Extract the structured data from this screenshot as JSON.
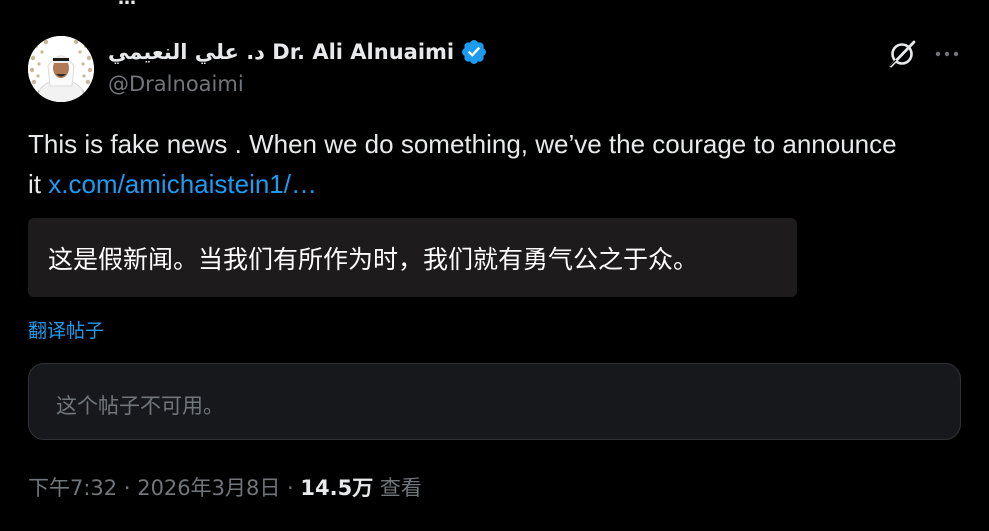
{
  "header": {
    "cut_text": "…"
  },
  "author": {
    "display_name": "د. علي النعيمي Dr. Ali Alnuaimi",
    "handle": "@Dralnoaimi",
    "verified_color": "#1d9bf0"
  },
  "tweet": {
    "text_before_link": "This is fake news . When we do something, we’ve the courage to announce it ",
    "link_text": "x.com/amichaistein1/…",
    "link_color": "#1d9bf0"
  },
  "translation": {
    "text": "这是假新闻。当我们有所作为时，我们就有勇气公之于众。",
    "translate_link_label": "翻译帖子"
  },
  "quoted": {
    "unavailable_text": "这个帖子不可用。"
  },
  "meta": {
    "time": "下午7:32",
    "separator1": " · ",
    "date": "2026年3月8日",
    "separator2": " · ",
    "views_count": "14.5万",
    "views_label": " 查看"
  },
  "icons": {
    "avatar": "avatar-image",
    "verified": "verified-badge-icon",
    "grok": "grok-icon",
    "more": "more-options-icon"
  },
  "colors": {
    "background": "#000000",
    "text_primary": "#e7e9ea",
    "text_secondary": "#71767b",
    "accent": "#1d9bf0",
    "translation_bg": "#1d1b1c"
  }
}
